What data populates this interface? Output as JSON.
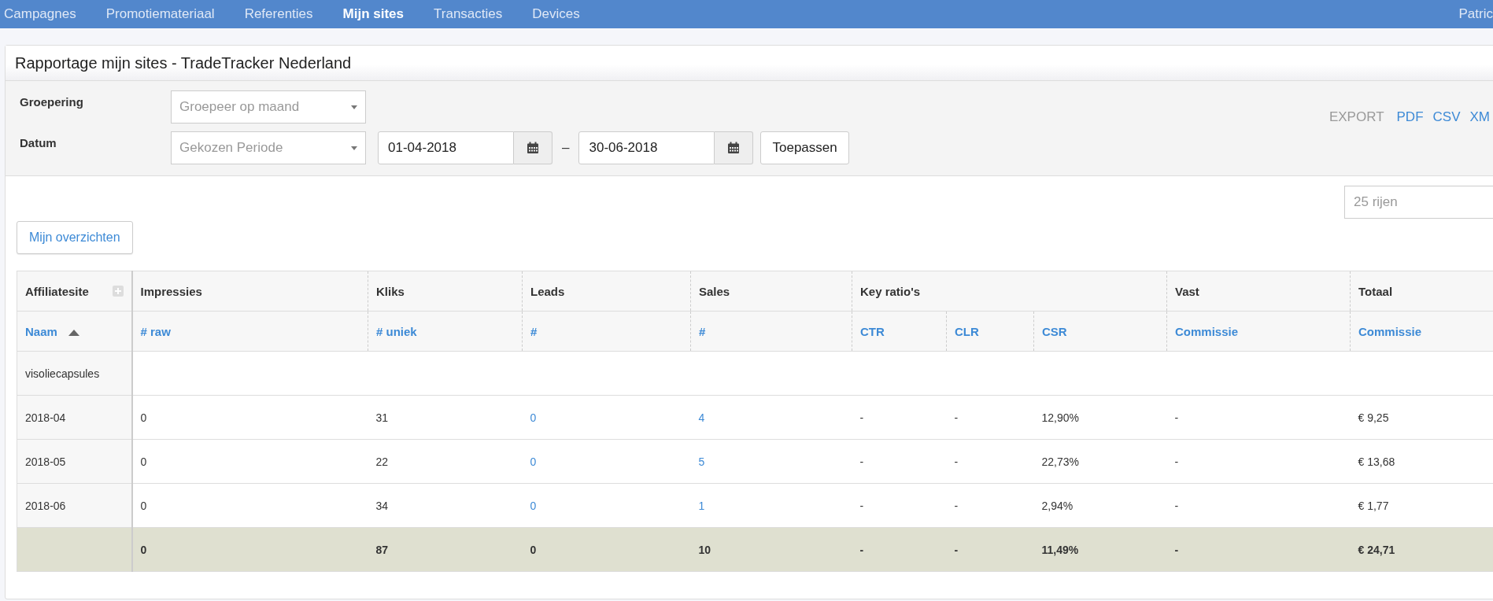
{
  "nav": {
    "items": [
      {
        "label": "Campagnes",
        "selected": false
      },
      {
        "label": "Promotiemateriaal",
        "selected": false
      },
      {
        "label": "Referenties",
        "selected": false
      },
      {
        "label": "Mijn sites",
        "selected": true
      },
      {
        "label": "Transacties",
        "selected": false
      },
      {
        "label": "Devices",
        "selected": false
      }
    ],
    "user": "Patric"
  },
  "panel": {
    "title": "Rapportage mijn sites - TradeTracker Nederland"
  },
  "filters": {
    "grouping": {
      "label": "Groepering",
      "value": "Groepeer op maand"
    },
    "date": {
      "label": "Datum",
      "period": "Gekozen Periode",
      "from": "01-04-2018",
      "separator": "–",
      "to": "30-06-2018"
    },
    "apply_button": "Toepassen",
    "export": {
      "label": "EXPORT",
      "links": [
        "PDF",
        "CSV",
        "XM"
      ]
    }
  },
  "rows_select": "25 rijen",
  "overview_button": "Mijn overzichten",
  "table": {
    "groups": [
      {
        "label": "Affiliatesite",
        "columns": [
          {
            "label": "Naam",
            "kind": "text",
            "sorted": true
          }
        ]
      },
      {
        "label": "Impressies",
        "columns": [
          {
            "label": "# raw",
            "kind": "text",
            "sorted": false
          }
        ]
      },
      {
        "label": "Kliks",
        "columns": [
          {
            "label": "# uniek",
            "kind": "text",
            "sorted": false
          }
        ]
      },
      {
        "label": "Leads",
        "columns": [
          {
            "label": "#",
            "kind": "link",
            "sorted": false
          }
        ]
      },
      {
        "label": "Sales",
        "columns": [
          {
            "label": "#",
            "kind": "link",
            "sorted": false
          }
        ]
      },
      {
        "label": "Key ratio's",
        "columns": [
          {
            "label": "CTR",
            "kind": "text",
            "sorted": false
          },
          {
            "label": "CLR",
            "kind": "text",
            "sorted": false
          },
          {
            "label": "CSR",
            "kind": "text",
            "sorted": false
          }
        ]
      },
      {
        "label": "Vast",
        "columns": [
          {
            "label": "Commissie",
            "kind": "text",
            "sorted": false
          }
        ]
      },
      {
        "label": "Totaal",
        "columns": [
          {
            "label": "Commissie",
            "kind": "text",
            "sorted": false
          }
        ]
      }
    ],
    "rows": [
      {
        "kind": "group",
        "cells": [
          "visoliecapsules"
        ]
      },
      {
        "kind": "data",
        "cells": [
          "2018-04",
          "0",
          "31",
          "0",
          "4",
          "-",
          "-",
          "12,90%",
          "-",
          "€ 9,25"
        ]
      },
      {
        "kind": "data",
        "cells": [
          "2018-05",
          "0",
          "22",
          "0",
          "5",
          "-",
          "-",
          "22,73%",
          "-",
          "€ 13,68"
        ]
      },
      {
        "kind": "data",
        "cells": [
          "2018-06",
          "0",
          "34",
          "0",
          "1",
          "-",
          "-",
          "2,94%",
          "-",
          "€ 1,77"
        ]
      },
      {
        "kind": "total",
        "cells": [
          "",
          "0",
          "87",
          "0",
          "10",
          "-",
          "-",
          "11,49%",
          "-",
          "€ 24,71"
        ]
      }
    ]
  }
}
